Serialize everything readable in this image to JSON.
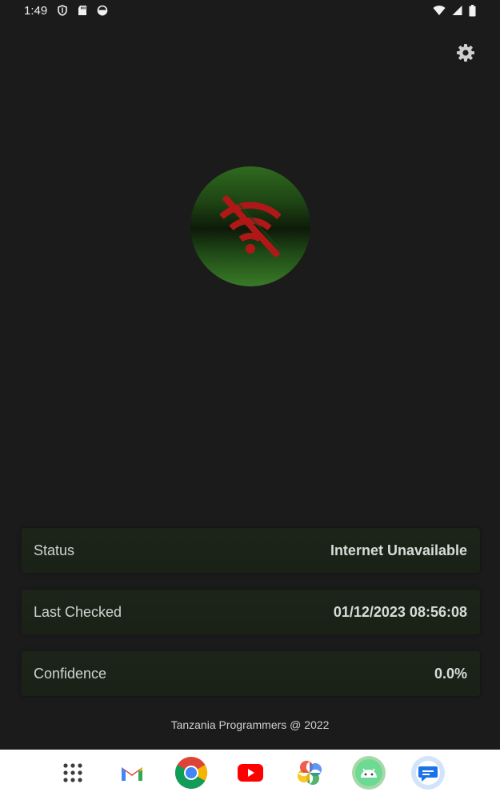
{
  "status_bar": {
    "time": "1:49",
    "icons": [
      "shield-icon",
      "sd-card-icon",
      "circle-status-icon",
      "wifi-icon",
      "signal-icon",
      "battery-icon"
    ]
  },
  "toolbar": {
    "settings_icon": "gear-icon"
  },
  "main": {
    "status_orb_icon": "wifi-off-icon",
    "colors": {
      "background": "#1a1b1a",
      "orb_green": "#3a7a28",
      "wifi_off_red": "#b01818"
    }
  },
  "cards": {
    "status": {
      "label": "Status",
      "value": "Internet Unavailable"
    },
    "last_checked": {
      "label": "Last Checked",
      "value": "01/12/2023 08:56:08"
    },
    "confidence": {
      "label": "Confidence",
      "value": "0.0%"
    }
  },
  "footer": {
    "text": "Tanzania Programmers @ 2022"
  },
  "dock": {
    "apps": [
      "app-drawer-icon",
      "gmail-icon",
      "chrome-icon",
      "youtube-icon",
      "photos-icon",
      "android-icon",
      "messages-icon"
    ]
  }
}
